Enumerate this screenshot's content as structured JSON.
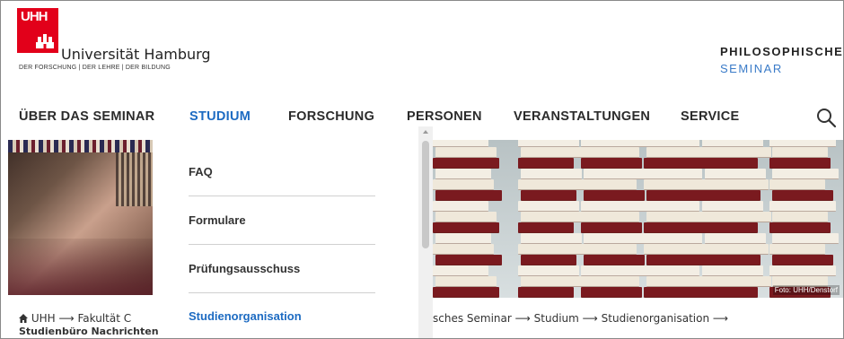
{
  "logo": {
    "abbr": "UHH",
    "name": "Universität Hamburg",
    "tagline": "DER FORSCHUNG | DER LEHRE | DER BILDUNG"
  },
  "institute": {
    "title": "PHILOSOPHISCHES",
    "subtitle": "SEMINAR"
  },
  "nav": {
    "items": [
      {
        "label": "ÜBER DAS SEMINAR"
      },
      {
        "label": "STUDIUM",
        "active": true
      },
      {
        "label": "FORSCHUNG"
      },
      {
        "label": "PERSONEN"
      },
      {
        "label": "VERANSTALTUNGEN"
      },
      {
        "label": "SERVICE"
      }
    ],
    "search_icon": "search-icon"
  },
  "dropdown": {
    "items": [
      {
        "label": "FAQ"
      },
      {
        "label": "Formulare"
      },
      {
        "label": "Prüfungsausschuss"
      },
      {
        "label": "Studienorganisation",
        "active": true
      }
    ]
  },
  "photo_credit": "Foto: UHH/Denstorf",
  "breadcrumb": {
    "left_line1": "UHH  ⟶  Fakultät C",
    "left_line2": "Studienbüro Nachrichten",
    "right": "sches Seminar  ⟶  Studium  ⟶  Studienorganisation  ⟶"
  },
  "colors": {
    "brand_red": "#e2001a",
    "accent_blue": "#1d6bc2"
  }
}
